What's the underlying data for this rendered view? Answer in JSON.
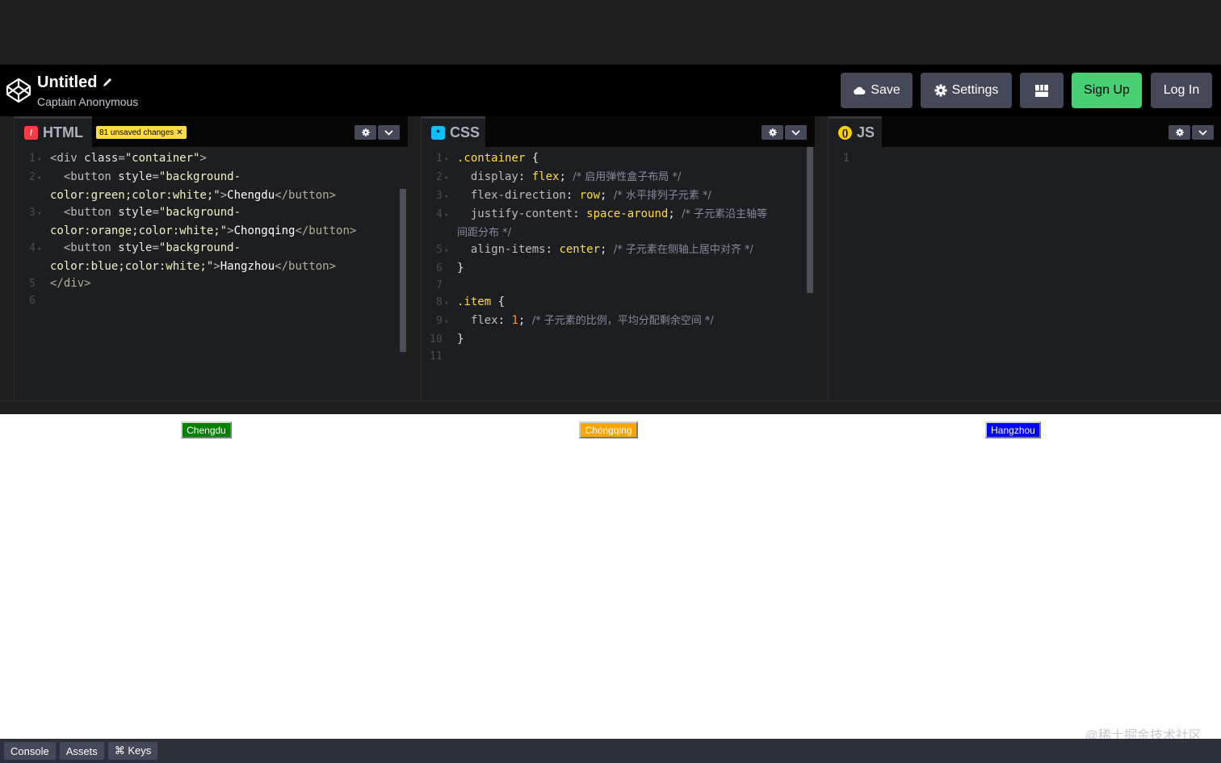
{
  "header": {
    "title": "Untitled",
    "author": "Captain Anonymous",
    "buttons": {
      "save": "Save",
      "settings": "Settings",
      "signup": "Sign Up",
      "login": "Log In"
    }
  },
  "editors": {
    "html": {
      "label": "HTML",
      "badge": "81 unsaved changes",
      "lines": [
        {
          "num": "1",
          "fold": true
        },
        {
          "num": "2",
          "fold": true
        },
        {
          "num": "3",
          "fold": true
        },
        {
          "num": "4",
          "fold": true
        },
        {
          "num": "5",
          "fold": false
        },
        {
          "num": "6",
          "fold": false
        }
      ],
      "code": {
        "l1_open": "<div ",
        "l1_attr": "class",
        "l1_eq": "=",
        "l1_str": "\"container\"",
        "l1_close": ">",
        "l2_open": "  <button ",
        "l2_attr": "style",
        "l2_str": "\"background-",
        "l2_wrap_str": "color:green;color:white;\"",
        "l2_text": "Chengdu",
        "l2_end": "</button>",
        "l3_str": "\"background-",
        "l3_wrap_str": "color:orange;color:white;\"",
        "l3_text": "Chongqing",
        "l3_end": "</button>",
        "l4_str": "\"background-",
        "l4_wrap_str": "color:blue;color:white;\"",
        "l4_text": "Hangzhou",
        "l4_end": "</button>",
        "l5": "</div>"
      }
    },
    "css": {
      "label": "CSS",
      "code": {
        "l1_sel": ".container",
        "l1_brace": " {",
        "l2_prop": "  display",
        "l2_val": "flex",
        "l2_com": "/* 启用弹性盒子布局 */",
        "l3_prop": "  flex-direction",
        "l3_val": "row",
        "l3_com": "/* 水平排列子元素 */",
        "l4_prop": "  justify-content",
        "l4_val": "space-around",
        "l4_com": "/* 子元素沿主轴等",
        "l4_wrap": "间距分布 */",
        "l5_prop": "  align-items",
        "l5_val": "center",
        "l5_com": "/* 子元素在侧轴上居中对齐 */",
        "l6": "}",
        "l8_sel": ".item",
        "l8_brace": " {",
        "l9_prop": "  flex",
        "l9_num": "1",
        "l9_com": "/* 子元素的比例，平均分配剩余空间 */",
        "l10": "}"
      }
    },
    "js": {
      "label": "JS",
      "line1": "1"
    }
  },
  "preview": {
    "buttons": [
      {
        "label": "Chengdu",
        "color": "#008000"
      },
      {
        "label": "Chongqing",
        "color": "#ffa500"
      },
      {
        "label": "Hangzhou",
        "color": "#0000ff"
      }
    ],
    "watermark": "@稀土掘金技术社区"
  },
  "footer": {
    "console": "Console",
    "assets": "Assets",
    "keys": "⌘ Keys"
  },
  "colors": {
    "signup": "#47cf73",
    "badge": "#ffdd40",
    "html_icon": "#ff3c41",
    "css_icon": "#0ebeff",
    "js_icon": "#fcd000"
  }
}
